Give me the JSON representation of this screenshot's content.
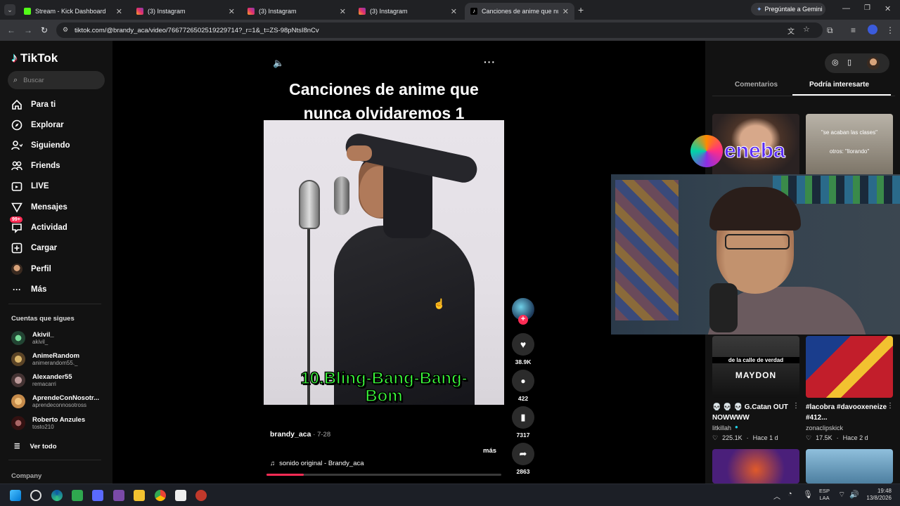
{
  "browser": {
    "tabs": [
      {
        "label": "Stream - Kick Dashboard",
        "icon": "kick-icon",
        "color": "#53fc18"
      },
      {
        "label": "(3) Instagram",
        "icon": "instagram-icon",
        "color": "#e1306c"
      },
      {
        "label": "(3) Instagram",
        "icon": "instagram-icon",
        "color": "#e1306c"
      },
      {
        "label": "(3) Instagram",
        "icon": "instagram-icon",
        "color": "#e1306c"
      },
      {
        "label": "Canciones de anime que nunca",
        "icon": "tiktok-icon",
        "color": "#ffffff"
      }
    ],
    "gemini_label": "Pregúntale a Gemini",
    "url": "tiktok.com/@brandy_aca/video/7667726502519229714?_r=1&_t=ZS-98pNtsI8nCv"
  },
  "tiktok": {
    "logo": "TikTok",
    "search_placeholder": "Buscar",
    "nav": [
      {
        "label": "Para ti",
        "icon": "home-icon"
      },
      {
        "label": "Explorar",
        "icon": "compass-icon"
      },
      {
        "label": "Siguiendo",
        "icon": "following-icon"
      },
      {
        "label": "Friends",
        "icon": "friends-icon"
      },
      {
        "label": "LIVE",
        "icon": "live-icon"
      },
      {
        "label": "Mensajes",
        "icon": "messages-icon"
      },
      {
        "label": "Actividad",
        "icon": "activity-icon",
        "badge": "99+"
      },
      {
        "label": "Cargar",
        "icon": "upload-icon"
      },
      {
        "label": "Perfil",
        "icon": "profile-icon"
      },
      {
        "label": "Más",
        "icon": "more-icon"
      }
    ],
    "following_header": "Cuentas que sigues",
    "accounts": [
      {
        "name": "Akivil_",
        "handle": "akivil_"
      },
      {
        "name": "AnimeRandom",
        "handle": "animerandom55._"
      },
      {
        "name": "Alexander55",
        "handle": "remacarri"
      },
      {
        "name": "AprendeConNosotr...",
        "handle": "aprendeconnosotross"
      },
      {
        "name": "Roberto Anzules",
        "handle": "tosto210"
      }
    ],
    "see_all": "Ver todo",
    "company": "Company"
  },
  "video": {
    "title_line1": "Canciones de anime que",
    "title_line2": "nunca olvidaremos  1",
    "caption_line1": "10.Bling-Bang-Bang-",
    "caption_line2": "Bom",
    "author": "brandy_aca",
    "date": "· 7-28",
    "more": "más",
    "sound": "sonido original - Brandy_aca",
    "progress": 0.16,
    "likes": "38.9K",
    "comments": "422",
    "saves": "7317",
    "shares": "2863"
  },
  "right_panel": {
    "tabs": [
      "Comentarios",
      "Podría interesarte"
    ],
    "thumb_texts": [
      "\"se acaban las clases\"",
      "otros: \"llorando\"",
      "de la calle de verdad",
      "MAYDON"
    ],
    "overlay_logo": "eneba",
    "cards": [
      {
        "title": "💀 💀 💀 G.Catan OUT NOWWWW",
        "user": "litkillah",
        "likes": "225.1K",
        "time": "Hace 1 d"
      },
      {
        "title": "#lacobra #davooxeneize #412...",
        "user": "zonaclipskick",
        "likes": "17.5K",
        "time": "Hace 2 d"
      }
    ]
  },
  "taskbar": {
    "lang1": "ESP",
    "lang2": "LAA",
    "time": "19:48",
    "date": "13/8/2026"
  },
  "colors": {
    "accent": "#fe2c55",
    "caption_green": "#3cff3c"
  }
}
